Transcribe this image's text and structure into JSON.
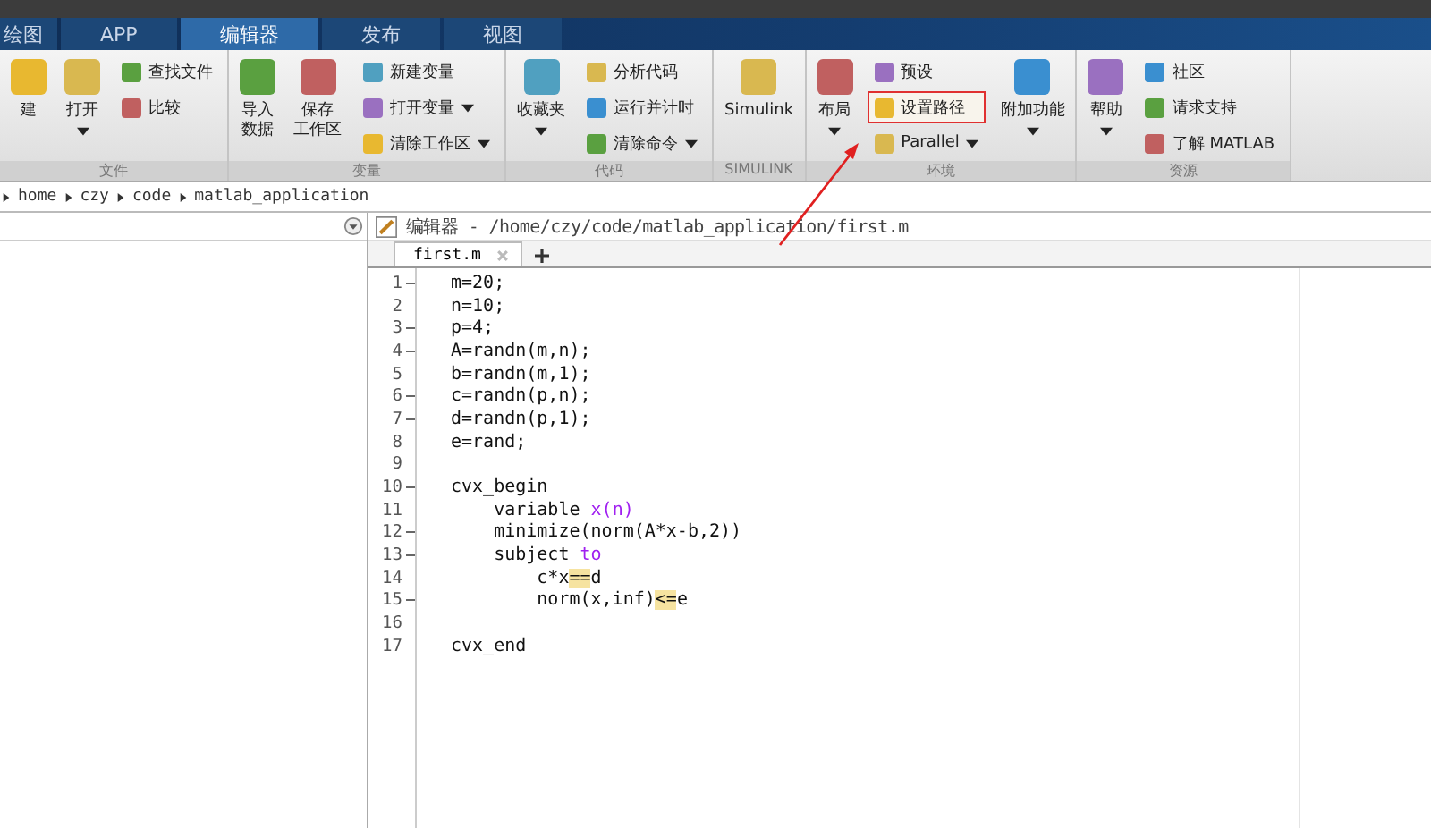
{
  "tabs": [
    {
      "label": "绘图",
      "selected": false
    },
    {
      "label": "APP",
      "selected": false
    },
    {
      "label": "编辑器",
      "selected": true
    },
    {
      "label": "发布",
      "selected": false
    },
    {
      "label": "视图",
      "selected": false
    }
  ],
  "ribbon": [
    {
      "label": "文件",
      "large": [
        {
          "label": "建",
          "dropdown": false
        },
        {
          "label": "打开",
          "dropdown": true
        }
      ],
      "small": [
        {
          "label": "查找文件",
          "dropdown": false,
          "highlighted": false
        },
        {
          "label": "比较",
          "dropdown": false,
          "highlighted": false
        }
      ]
    },
    {
      "label": "变量",
      "large": [
        {
          "label": [
            "导入",
            "数据"
          ],
          "dropdown": false
        },
        {
          "label": [
            "保存",
            "工作区"
          ],
          "dropdown": false
        }
      ],
      "small": [
        {
          "label": "新建变量",
          "dropdown": false,
          "highlighted": false
        },
        {
          "label": "打开变量",
          "dropdown": true,
          "highlighted": false
        },
        {
          "label": "清除工作区",
          "dropdown": true,
          "highlighted": false
        }
      ]
    },
    {
      "label": "代码",
      "large": [
        {
          "label": "收藏夹",
          "dropdown": true
        }
      ],
      "small": [
        {
          "label": "分析代码",
          "dropdown": false,
          "highlighted": false
        },
        {
          "label": "运行并计时",
          "dropdown": false,
          "highlighted": false
        },
        {
          "label": "清除命令",
          "dropdown": true,
          "highlighted": false
        }
      ]
    },
    {
      "label": "SIMULINK",
      "large": [
        {
          "label": "Simulink",
          "dropdown": false
        }
      ]
    },
    {
      "label": "环境",
      "large": [
        {
          "label": "布局",
          "dropdown": true
        }
      ],
      "small": [
        {
          "label": "预设",
          "dropdown": false,
          "highlighted": false
        },
        {
          "label": "设置路径",
          "dropdown": false,
          "highlighted": true
        },
        {
          "label": "Parallel",
          "dropdown": true,
          "highlighted": false
        }
      ],
      "large_after": [
        {
          "label": "附加功能",
          "dropdown": true
        }
      ]
    },
    {
      "label": "资源",
      "large": [
        {
          "label": "帮助",
          "dropdown": true
        }
      ],
      "small": [
        {
          "label": "社区",
          "dropdown": false,
          "highlighted": false
        },
        {
          "label": "请求支持",
          "dropdown": false,
          "highlighted": false
        },
        {
          "label": "了解 MATLAB",
          "dropdown": false,
          "highlighted": false
        }
      ]
    }
  ],
  "breadcrumb": [
    "home",
    "czy",
    "code",
    "matlab_application"
  ],
  "editor": {
    "title": "编辑器 - /home/czy/code/matlab_application/first.m",
    "tabs": [
      {
        "label": "first.m",
        "selected": true
      }
    ],
    "lines": [
      {
        "number": "1",
        "executable": true,
        "tokens": [
          {
            "text": "m=20;",
            "kind": "plain"
          }
        ]
      },
      {
        "number": "2",
        "executable": false,
        "tokens": [
          {
            "text": "n=10;",
            "kind": "plain"
          }
        ]
      },
      {
        "number": "3",
        "executable": true,
        "tokens": [
          {
            "text": "p=4;",
            "kind": "plain"
          }
        ]
      },
      {
        "number": "4",
        "executable": true,
        "tokens": [
          {
            "text": "A=randn(m,n);",
            "kind": "plain"
          }
        ]
      },
      {
        "number": "5",
        "executable": false,
        "tokens": [
          {
            "text": "b=randn(m,1);",
            "kind": "plain"
          }
        ]
      },
      {
        "number": "6",
        "executable": true,
        "tokens": [
          {
            "text": "c=randn(p,n);",
            "kind": "plain"
          }
        ]
      },
      {
        "number": "7",
        "executable": true,
        "tokens": [
          {
            "text": "d=randn(p,1);",
            "kind": "plain"
          }
        ]
      },
      {
        "number": "8",
        "executable": false,
        "tokens": [
          {
            "text": "e=rand;",
            "kind": "plain"
          }
        ]
      },
      {
        "number": "9",
        "executable": false
      },
      {
        "number": "10",
        "executable": true,
        "tokens": [
          {
            "text": "cvx_begin",
            "kind": "plain"
          }
        ]
      },
      {
        "number": "11",
        "executable": false,
        "tokens": [
          {
            "text": "    variable ",
            "kind": "plain"
          },
          {
            "text": "x(n)",
            "kind": "keyword"
          }
        ]
      },
      {
        "number": "12",
        "executable": true,
        "tokens": [
          {
            "text": "    minimize(norm(A*x-b,2))",
            "kind": "plain"
          }
        ]
      },
      {
        "number": "13",
        "executable": true,
        "tokens": [
          {
            "text": "    subject ",
            "kind": "plain"
          },
          {
            "text": "to",
            "kind": "keyword"
          }
        ]
      },
      {
        "number": "14",
        "executable": false,
        "tokens": [
          {
            "text": "        c*x",
            "kind": "plain"
          },
          {
            "text": "==",
            "kind": "highlight"
          },
          {
            "text": "d",
            "kind": "plain"
          }
        ]
      },
      {
        "number": "15",
        "executable": true,
        "tokens": [
          {
            "text": "        norm(x,inf)",
            "kind": "plain"
          },
          {
            "text": "<=",
            "kind": "highlight"
          },
          {
            "text": "e",
            "kind": "plain"
          }
        ]
      },
      {
        "number": "16",
        "executable": false
      },
      {
        "number": "17",
        "executable": false,
        "tokens": [
          {
            "text": "cvx_end",
            "kind": "plain"
          }
        ]
      }
    ]
  }
}
